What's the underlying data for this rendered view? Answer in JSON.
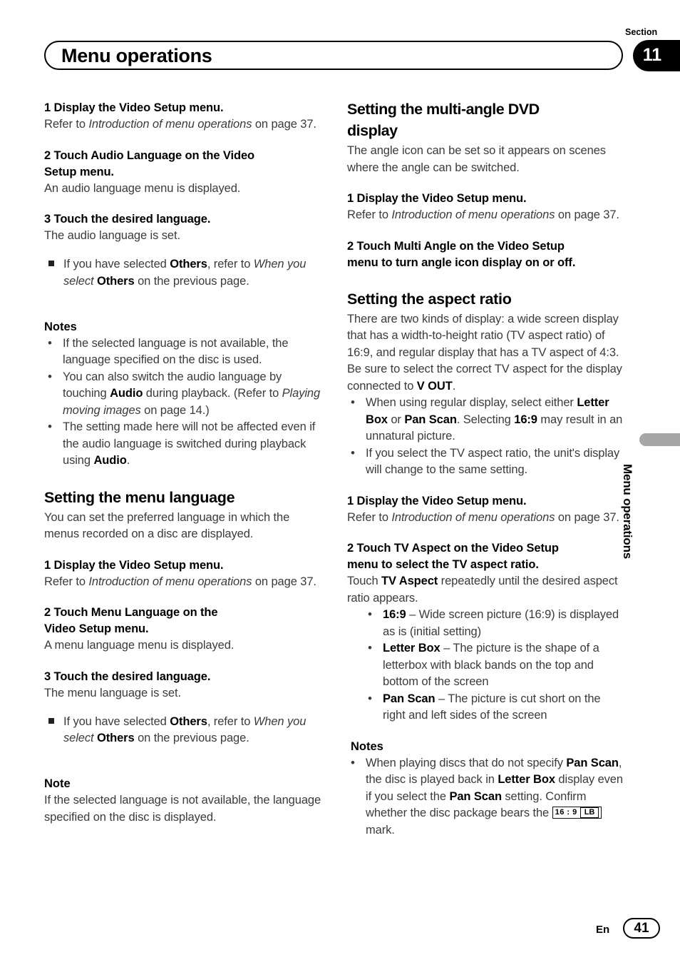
{
  "header": {
    "title": "Menu operations",
    "section_label": "Section",
    "section_number": "11"
  },
  "side_tab": {
    "label": "Menu operations"
  },
  "footer": {
    "language": "En",
    "page_number": "41"
  },
  "left_column": {
    "audio_language": {
      "step1_title": "1    Display the Video Setup menu.",
      "step1_body_a": "Refer to ",
      "step1_body_i": "Introduction of menu operations",
      "step1_body_b": " on page 37.",
      "step2_title_l1": "2    Touch Audio Language on the Video",
      "step2_title_l2": "Setup menu.",
      "step2_body": "An audio language menu is displayed.",
      "step3_title": "3    Touch the desired language.",
      "step3_body": "The audio language is set.",
      "step3_sq_a": "If you have selected ",
      "step3_sq_b": "Others",
      "step3_sq_c": ", refer to ",
      "step3_sq_i": "When you select",
      "step3_sq_d": " ",
      "step3_sq_e": "Others",
      "step3_sq_f": " on the previous page."
    },
    "notes": {
      "heading": "Notes",
      "item1": "If the selected language is not available, the language specified on the disc is used.",
      "item2_a": "You can also switch the audio language by touching ",
      "item2_b": "Audio",
      "item2_c": " during playback. (Refer to ",
      "item2_i": "Playing moving images",
      "item2_d": " on page 14.)",
      "item3_a": "The setting made here will not be affected even if the audio language is switched during playback using ",
      "item3_b": "Audio",
      "item3_c": "."
    },
    "menu_language": {
      "heading": "Setting the menu language",
      "intro": "You can set the preferred language in which the menus recorded on a disc are displayed.",
      "step1_title": "1    Display the Video Setup menu.",
      "step1_body_a": "Refer to ",
      "step1_body_i": "Introduction of menu operations",
      "step1_body_b": " on page 37.",
      "step2_title_l1": "2    Touch Menu Language on the",
      "step2_title_l2": "Video Setup menu.",
      "step2_body": "A menu language menu is displayed.",
      "step3_title": "3    Touch the desired language.",
      "step3_body": "The menu language is set.",
      "step3_sq_a": "If you have selected ",
      "step3_sq_b": "Others",
      "step3_sq_c": ", refer to ",
      "step3_sq_i": "When you select",
      "step3_sq_d": " ",
      "step3_sq_e": "Others",
      "step3_sq_f": " on the previous page.",
      "note_heading": "Note",
      "note_body": "If the selected language is not available, the language specified on the disc is displayed."
    }
  },
  "right_column": {
    "multi_angle": {
      "heading_l1": "Setting the multi-angle DVD",
      "heading_l2": "display",
      "intro": "The angle icon can be set so it appears on scenes where the angle can be switched.",
      "step1_title": "1    Display the Video Setup menu.",
      "step1_body_a": "Refer to ",
      "step1_body_i": "Introduction of menu operations",
      "step1_body_b": " on page 37.",
      "step2_title_l1": "2    Touch Multi Angle on the Video Setup",
      "step2_title_l2": "menu to turn angle icon display on or off."
    },
    "aspect_ratio": {
      "heading": "Setting the aspect ratio",
      "intro_a": "There are two kinds of display: a wide screen display that has a width-to-height ratio (TV aspect ratio) of 16:9, and regular display that has a TV aspect of 4:3. Be sure to select the correct TV aspect for the display connected to ",
      "intro_b": "V OUT",
      "intro_c": ".",
      "bullet1_a": "When using regular display, select either ",
      "bullet1_b": "Letter Box",
      "bullet1_c": " or ",
      "bullet1_d": "Pan Scan",
      "bullet1_e": ". Selecting ",
      "bullet1_f": "16:9",
      "bullet1_g": " may result in an unnatural picture.",
      "bullet2": "If you select the TV aspect ratio, the unit's display will change to the same setting.",
      "step1_title": "1    Display the Video Setup menu.",
      "step1_body_a": "Refer to ",
      "step1_body_i": "Introduction of menu operations",
      "step1_body_b": " on page 37.",
      "step2_title_l1": "2    Touch TV Aspect on the Video Setup",
      "step2_title_l2": "menu to select the TV aspect ratio.",
      "step2_body_a": "Touch ",
      "step2_body_b": "TV Aspect",
      "step2_body_c": " repeatedly until the desired aspect ratio appears.",
      "option1_label": "16:9",
      "option1_text": " – Wide screen picture (16:9) is displayed as is (initial setting)",
      "option2_label": "Letter Box",
      "option2_text": " – The picture is the shape of a letterbox with black bands on the top and bottom of the screen",
      "option3_label": "Pan Scan",
      "option3_text": " – The picture is cut short on the right and left sides of the screen",
      "notes_heading": "Notes",
      "note1_a": "When playing discs that do not specify ",
      "note1_b": "Pan Scan",
      "note1_c": ", the disc is played back in ",
      "note1_d": "Letter Box",
      "note1_e": " display even if you select the ",
      "note1_f": "Pan Scan",
      "note1_g": " setting. Confirm whether the disc package bears the ",
      "note1_h": " mark.",
      "mark_ratio": "16 : 9",
      "mark_lb": "LB"
    }
  }
}
